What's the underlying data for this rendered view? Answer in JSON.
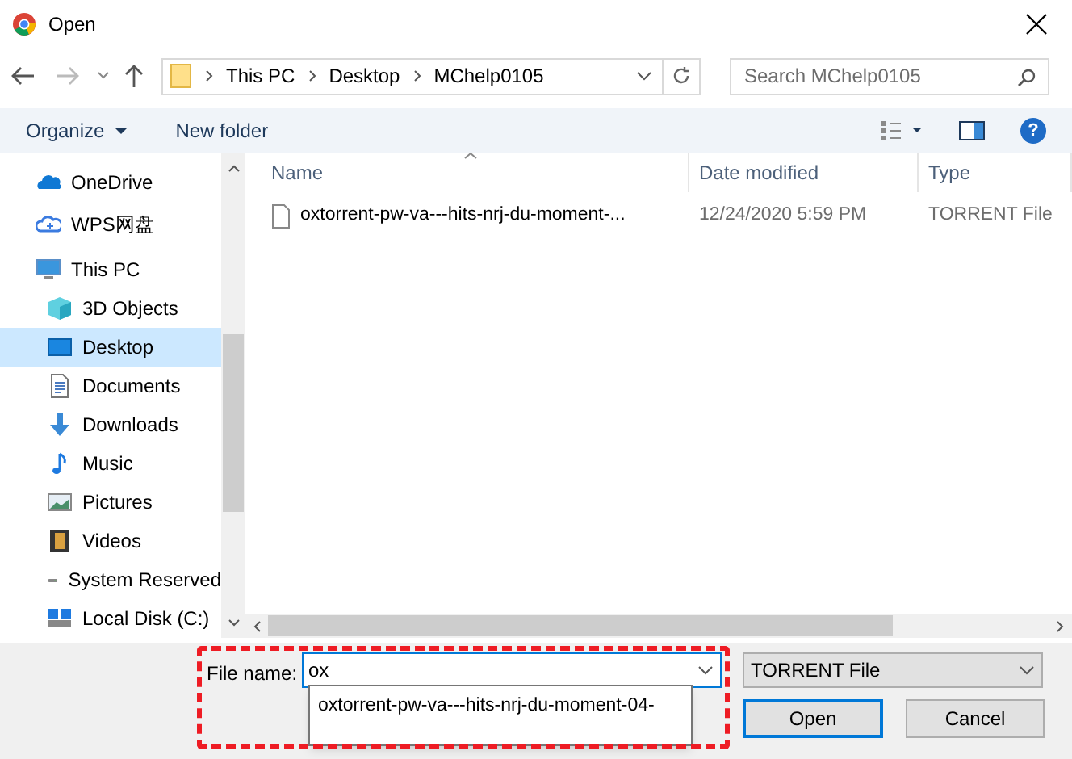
{
  "window": {
    "title": "Open"
  },
  "address": {
    "path": [
      "This PC",
      "Desktop",
      "MChelp0105"
    ],
    "search_placeholder": "Search MChelp0105"
  },
  "toolbar": {
    "organize": "Organize",
    "new_folder": "New folder",
    "help": "?"
  },
  "nav": [
    {
      "label": "OneDrive",
      "kind": "onedrive",
      "selected": false
    },
    {
      "label": "WPS网盘",
      "kind": "cloud",
      "selected": false
    },
    {
      "label": "This PC",
      "kind": "pc",
      "selected": false,
      "children": [
        {
          "label": "3D Objects",
          "kind": "cube",
          "selected": false
        },
        {
          "label": "Desktop",
          "kind": "desktop",
          "selected": true
        },
        {
          "label": "Documents",
          "kind": "document",
          "selected": false
        },
        {
          "label": "Downloads",
          "kind": "download",
          "selected": false
        },
        {
          "label": "Music",
          "kind": "music",
          "selected": false
        },
        {
          "label": "Pictures",
          "kind": "picture",
          "selected": false
        },
        {
          "label": "Videos",
          "kind": "video",
          "selected": false
        },
        {
          "label": "System Reserved",
          "kind": "drive",
          "selected": false
        },
        {
          "label": "Local Disk (C:)",
          "kind": "windows",
          "selected": false
        }
      ]
    }
  ],
  "table": {
    "columns": [
      "Name",
      "Date modified",
      "Type"
    ],
    "rows": [
      {
        "name": "oxtorrent-pw-va---hits-nrj-du-moment-...",
        "date": "12/24/2020 5:59 PM",
        "type": "TORRENT File"
      }
    ]
  },
  "bottom": {
    "file_name_label": "File name:",
    "file_name_value": "ox",
    "suggestion": "oxtorrent-pw-va---hits-nrj-du-moment-04-",
    "file_type": "TORRENT File",
    "open": "Open",
    "cancel": "Cancel"
  }
}
